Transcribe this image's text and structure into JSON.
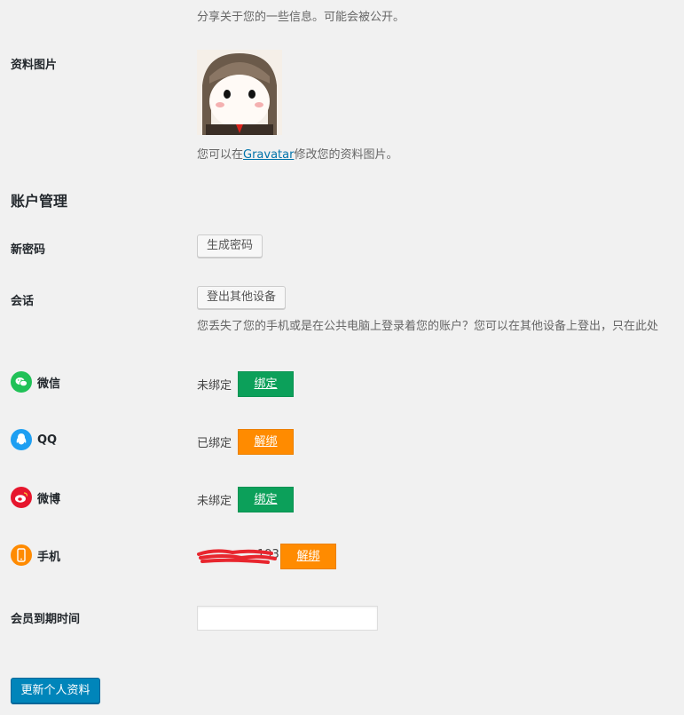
{
  "bio": {
    "description": "分享关于您的一些信息。可能会被公开。"
  },
  "profile_picture": {
    "label": "资料图片",
    "desc_before": "您可以在",
    "link_text": "Gravatar",
    "desc_after": "修改您的资料图片。"
  },
  "account": {
    "title": "账户管理",
    "new_password_label": "新密码",
    "generate_password_btn": "生成密码",
    "session_label": "会话",
    "logout_others_btn": "登出其他设备",
    "session_desc": "您丢失了您的手机或是在公共电脑上登录着您的账户？您可以在其他设备上登出，只在此处"
  },
  "social": [
    {
      "name": "微信",
      "icon": "wechat-icon",
      "color": "#20c157",
      "status": "未绑定",
      "action": "绑定",
      "action_color": "#0ca05a"
    },
    {
      "name": "QQ",
      "icon": "qq-icon",
      "color": "#1e9ff2",
      "status": "已绑定",
      "action": "解绑",
      "action_color": "#ff8b00"
    },
    {
      "name": "微博",
      "icon": "weibo-icon",
      "color": "#e6162d",
      "status": "未绑定",
      "action": "绑定",
      "action_color": "#0ca05a"
    }
  ],
  "phone": {
    "label": "手机",
    "icon": "phone-icon",
    "color": "#ff8b00",
    "number_visible_suffix": "193",
    "action": "解绑"
  },
  "membership": {
    "label": "会员到期时间",
    "value": ""
  },
  "submit": {
    "label": "更新个人资料"
  }
}
